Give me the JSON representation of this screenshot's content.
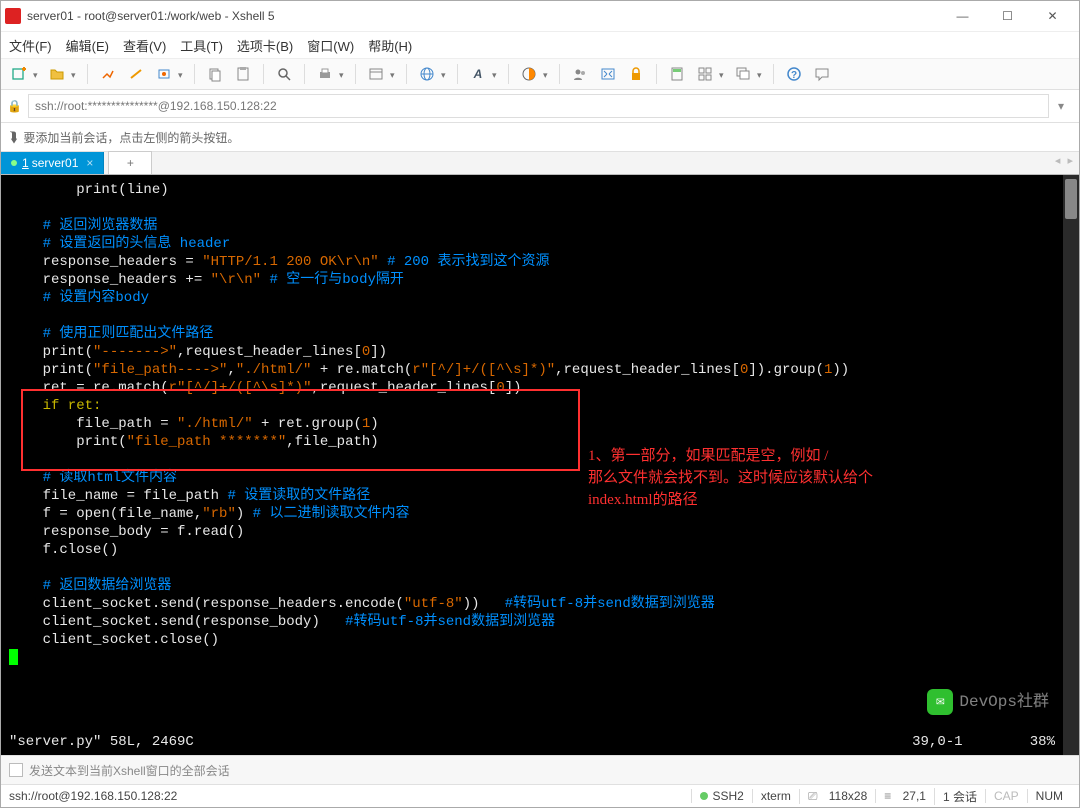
{
  "window": {
    "title": "server01 - root@server01:/work/web - Xshell 5"
  },
  "menu": [
    "文件(F)",
    "编辑(E)",
    "查看(V)",
    "工具(T)",
    "选项卡(B)",
    "窗口(W)",
    "帮助(H)"
  ],
  "address": {
    "value": "ssh://root:***************@192.168.150.128:22"
  },
  "hint": "要添加当前会话，点击左侧的箭头按钮。",
  "tab": {
    "num": "1",
    "label": "server01"
  },
  "annotation": {
    "l1": "1、第一部分，如果匹配是空，例如 /",
    "l2": "那么文件就会找不到。这时候应该默认给个",
    "l3": "index.html的路径"
  },
  "vim_status": {
    "file": "\"server.py\" 58L, 2469C",
    "pos": "39,0-1",
    "pct": "38%"
  },
  "sendbar": "发送文本到当前Xshell窗口的全部会话",
  "status": {
    "left": "ssh://root@192.168.150.128:22",
    "ssh": "SSH2",
    "term": "xterm",
    "size": "118x28",
    "cursor": "27,1",
    "sess": "1 会话",
    "cap": "CAP",
    "num": "NUM"
  },
  "code": {
    "l01": "        print(line)",
    "l02_c": "    # 返回浏览器数据",
    "l03_c": "    # 设置返回的头信息 header",
    "l04a": "    response_headers = ",
    "l04b": "\"HTTP/1.1 200 OK\\r\\n\"",
    "l04c": " # 200 表示找到这个资源",
    "l05a": "    response_headers += ",
    "l05b": "\"\\r\\n\"",
    "l05c": " # 空一行与body隔开",
    "l06_c": "    # 设置内容body",
    "l07_c": "    # 使用正则匹配出文件路径",
    "l08a": "    print(",
    "l08b": "\"------->\"",
    "l08c": ",request_header_lines[",
    "l08d": "0",
    "l08e": "])",
    "l09a": "    print(",
    "l09b": "\"file_path---->\"",
    "l09c": ",",
    "l09d": "\"./html/\"",
    "l09e": " + re.match(",
    "l09f": "r\"[^/]+/([^\\s]*)\"",
    "l09g": ",request_header_lines[",
    "l09h": "0",
    "l09i": "]).group(",
    "l09j": "1",
    "l09k": "))",
    "l10a": "    ret = re.match(",
    "l10b": "r\"[^/]+/([^\\s]*)\"",
    "l10c": ",request_header_lines[",
    "l10d": "0",
    "l10e": "])",
    "l11": "    if ret:",
    "l12a": "        file_path = ",
    "l12b": "\"./html/\"",
    "l12c": " + ret.group(",
    "l12d": "1",
    "l12e": ")",
    "l13a": "        print(",
    "l13b": "\"file_path *******\"",
    "l13c": ",file_path)",
    "l14_c": "    # 读取html文件内容",
    "l15a": "    file_name = file_path ",
    "l15b": "# 设置读取的文件路径",
    "l16a": "    f = open(file_name,",
    "l16b": "\"rb\"",
    "l16c": ") ",
    "l16d": "# 以二进制读取文件内容",
    "l17": "    response_body = f.read()",
    "l18": "    f.close()",
    "l19_c": "    # 返回数据给浏览器",
    "l20a": "    client_socket.send(response_headers.encode(",
    "l20b": "\"utf-8\"",
    "l20c": "))   ",
    "l20d": "#转码utf-8并send数据到浏览器",
    "l21a": "    client_socket.send(response_body)   ",
    "l21b": "#转码utf-8并send数据到浏览器",
    "l22": "    client_socket.close()"
  },
  "watermark": "DevOps社群"
}
